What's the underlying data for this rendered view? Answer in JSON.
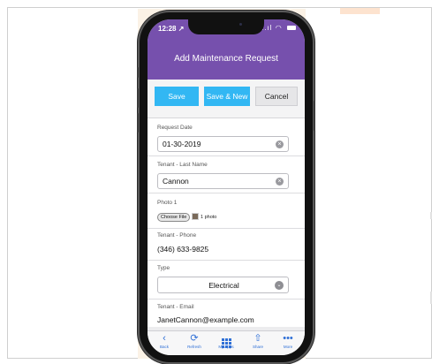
{
  "status_bar": {
    "time": "12:28",
    "location_glyph": "↗",
    "signal_glyph": "..ıl"
  },
  "header": {
    "title": "Add Maintenance Request"
  },
  "actions": {
    "save": "Save",
    "save_new": "Save & New",
    "cancel": "Cancel"
  },
  "fields": {
    "request_date": {
      "label": "Request Date",
      "value": "01-30-2019"
    },
    "tenant_last_name": {
      "label": "Tenant - Last Name",
      "value": "Cannon"
    },
    "photo": {
      "label": "Photo 1",
      "button": "Choose File",
      "count": "1 photo"
    },
    "tenant_phone": {
      "label": "Tenant - Phone",
      "value": "(346) 633-9825"
    },
    "type": {
      "label": "Type",
      "value": "Electrical"
    },
    "tenant_email": {
      "label": "Tenant - Email",
      "value": "JanetCannon@example.com"
    }
  },
  "tabbar": {
    "back": "Back",
    "refresh": "Refresh",
    "my_apps": "My Apps",
    "share": "Share",
    "more": "More"
  },
  "icons": {
    "clear": "clear-circle-icon",
    "chevron": "chevron-down-circle-icon",
    "back": "chevron-left-icon",
    "refresh": "refresh-icon",
    "apps": "grid-icon",
    "share": "share-icon",
    "more": "more-dots-icon"
  },
  "colors": {
    "header": "#7650ad",
    "primary_button": "#32b7f3",
    "tab_icons": "#2f6fd6",
    "accent_panel": "#fbf2e6"
  }
}
